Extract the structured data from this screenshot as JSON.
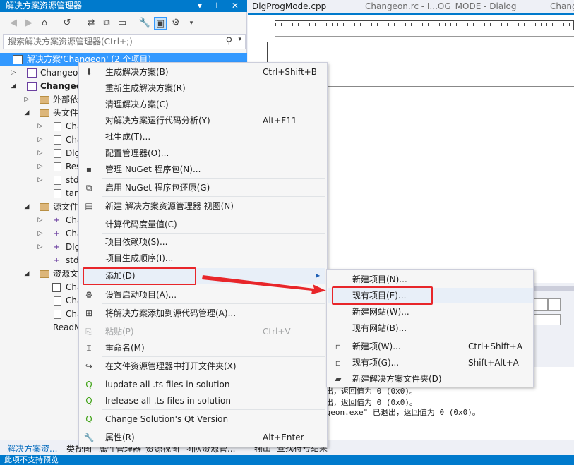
{
  "solution_explorer": {
    "title": "解决方案资源管理器",
    "title_controls": "▾ ⊥ ✕",
    "search_placeholder": "搜索解决方案资源管理器(Ctrl+;)",
    "toolbar_icons": [
      "back-icon",
      "forward-icon",
      "home-icon",
      "history-icon",
      "sync-icon",
      "collapse-icon",
      "properties-icon",
      "show-all-files-icon",
      "class-view-icon",
      "dropdown-icon"
    ],
    "tree": [
      {
        "label": "解决方案'Changeon' (2 个项目)",
        "icon": "solution",
        "twisty": ""
      },
      {
        "label": "Changeo",
        "icon": "proj",
        "twisty": "▷"
      },
      {
        "label": "Changeo",
        "icon": "proj",
        "twisty": "◢",
        "bold": true
      },
      {
        "label": "外部依",
        "icon": "folder",
        "twisty": "▷"
      },
      {
        "label": "头文件",
        "icon": "folder",
        "twisty": "◢"
      },
      {
        "label": "Cha",
        "icon": "file",
        "twisty": "▷"
      },
      {
        "label": "Cha",
        "icon": "file",
        "twisty": "▷"
      },
      {
        "label": "Dlg",
        "icon": "file",
        "twisty": "▷"
      },
      {
        "label": "Res",
        "icon": "file",
        "twisty": "▷"
      },
      {
        "label": "std",
        "icon": "file",
        "twisty": "▷"
      },
      {
        "label": "targ",
        "icon": "file",
        "twisty": ""
      },
      {
        "label": "源文件",
        "icon": "folder",
        "twisty": "◢"
      },
      {
        "label": "Cha",
        "icon": "cpp",
        "twisty": "▷"
      },
      {
        "label": "Cha",
        "icon": "cpp",
        "twisty": "▷"
      },
      {
        "label": "Dlg",
        "icon": "cpp",
        "twisty": "▷"
      },
      {
        "label": "std",
        "icon": "cpp",
        "twisty": ""
      },
      {
        "label": "资源文",
        "icon": "folder",
        "twisty": "◢"
      },
      {
        "label": "Cha",
        "icon": "img",
        "twisty": ""
      },
      {
        "label": "Cha",
        "icon": "file",
        "twisty": ""
      },
      {
        "label": "Cha",
        "icon": "file",
        "twisty": ""
      },
      {
        "label": "ReadM",
        "icon": "file",
        "twisty": ""
      }
    ],
    "bottom_tabs": [
      "解决方案资...",
      "类视图",
      "属性管理器",
      "资源视图",
      "团队资源管...",
      "输出",
      "查找符号结果"
    ]
  },
  "status_bar": {
    "text": "此项不支持预览"
  },
  "document_tabs": [
    {
      "label": "DlgProgMode.cpp",
      "active": true
    },
    {
      "label": "Changeon.rc - I...OG_MODE - Dialog",
      "active": false
    },
    {
      "label": "Chang",
      "active": false
    }
  ],
  "output_lines": [
    "出，返回值为 0 (0x0)。",
    "出，返回值为 0 (0x0)。",
    "ngeon.exe\" 已退出，返回值为 0 (0x0)。"
  ],
  "context_menu": {
    "items": [
      {
        "label": "生成解决方案(B)",
        "shortcut": "Ctrl+Shift+B",
        "icon": "build-icon"
      },
      {
        "label": "重新生成解决方案(R)",
        "shortcut": "",
        "icon": ""
      },
      {
        "label": "清理解决方案(C)",
        "shortcut": "",
        "icon": ""
      },
      {
        "label": "对解决方案运行代码分析(Y)",
        "shortcut": "Alt+F11",
        "icon": ""
      },
      {
        "label": "批生成(T)...",
        "shortcut": "",
        "icon": ""
      },
      {
        "label": "配置管理器(O)...",
        "shortcut": "",
        "icon": ""
      },
      {
        "label": "管理 NuGet 程序包(N)...",
        "shortcut": "",
        "icon": "nuget-icon"
      },
      {
        "label": "启用 NuGet 程序包还原(G)",
        "shortcut": "",
        "icon": "restore-icon"
      },
      {
        "label": "新建 解决方案资源管理器 视图(N)",
        "shortcut": "",
        "icon": "new-view-icon"
      },
      {
        "label": "计算代码度量值(C)",
        "shortcut": "",
        "icon": ""
      },
      {
        "label": "项目依赖项(S)...",
        "shortcut": "",
        "icon": ""
      },
      {
        "label": "项目生成顺序(I)...",
        "shortcut": "",
        "icon": ""
      },
      {
        "label": "添加(D)",
        "shortcut": "",
        "icon": "",
        "submenu": true
      },
      {
        "label": "设置启动项目(A)...",
        "shortcut": "",
        "icon": "gear-icon"
      },
      {
        "label": "将解决方案添加到源代码管理(A)...",
        "shortcut": "",
        "icon": "source-control-icon"
      },
      {
        "label": "粘贴(P)",
        "shortcut": "Ctrl+V",
        "icon": "paste-icon",
        "disabled": true
      },
      {
        "label": "重命名(M)",
        "shortcut": "",
        "icon": "rename-icon"
      },
      {
        "label": "在文件资源管理器中打开文件夹(X)",
        "shortcut": "",
        "icon": "open-folder-icon"
      },
      {
        "label": "lupdate all .ts files in solution",
        "shortcut": "",
        "icon": "qt-icon"
      },
      {
        "label": "lrelease all .ts files in solution",
        "shortcut": "",
        "icon": "qt-icon"
      },
      {
        "label": "Change Solution's Qt Version",
        "shortcut": "",
        "icon": "qt-icon"
      },
      {
        "label": "属性(R)",
        "shortcut": "Alt+Enter",
        "icon": "wrench-icon"
      }
    ]
  },
  "submenu": {
    "items": [
      {
        "label": "新建项目(N)...",
        "shortcut": "",
        "icon": ""
      },
      {
        "label": "现有项目(E)...",
        "shortcut": "",
        "icon": ""
      },
      {
        "label": "新建网站(W)...",
        "shortcut": "",
        "icon": ""
      },
      {
        "label": "现有网站(B)...",
        "shortcut": "",
        "icon": ""
      },
      {
        "label": "新建项(W)...",
        "shortcut": "Ctrl+Shift+A",
        "icon": "new-item-icon"
      },
      {
        "label": "现有项(G)...",
        "shortcut": "Shift+Alt+A",
        "icon": "existing-item-icon"
      },
      {
        "label": "新建解决方案文件夹(D)",
        "shortcut": "",
        "icon": "new-folder-icon"
      }
    ]
  },
  "colors": {
    "accent": "#007acc",
    "selection": "#3399ff",
    "annotation": "#e8262a"
  }
}
